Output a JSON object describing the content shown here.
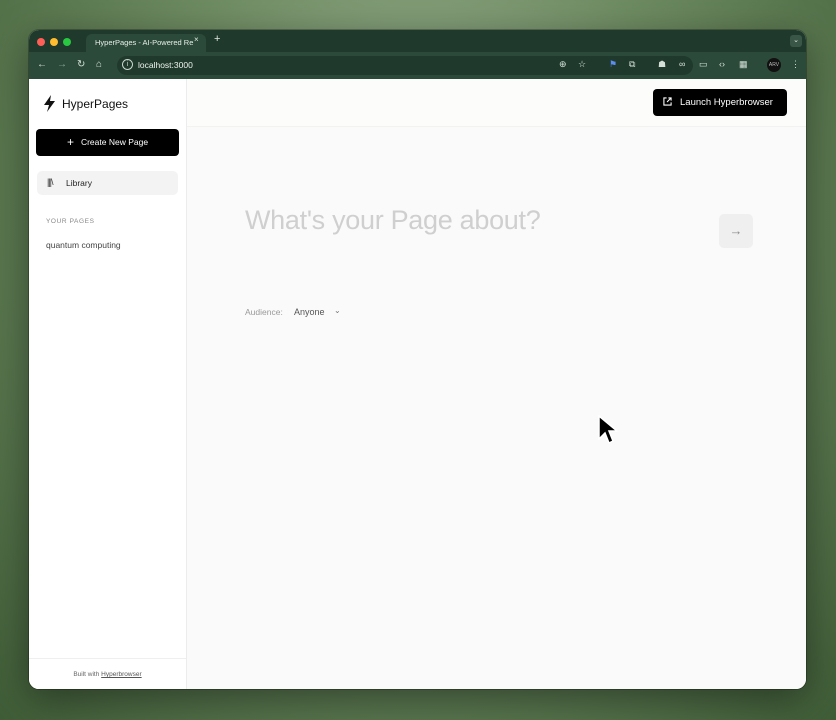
{
  "browser": {
    "tab_title": "HyperPages - AI-Powered Re",
    "tab_close": "×",
    "new_tab": "+",
    "url": "localhost:3000",
    "icons": [
      "back-icon",
      "forward-icon",
      "reload-icon",
      "home-icon",
      "site-info-icon",
      "zoom-icon",
      "bookmark-star-icon",
      "extension-icon",
      "puzzle-icon",
      "profile-avatar",
      "menu-icon"
    ],
    "profile_initials": "ARV"
  },
  "sidebar": {
    "brand": "HyperPages",
    "create_label": "Create New Page",
    "library_label": "Library",
    "section_title": "YOUR PAGES",
    "pages": [
      "quantum computing"
    ],
    "footer_prefix": "Built with",
    "footer_link": "Hyperbrowser"
  },
  "main": {
    "launch_label": "Launch Hyperbrowser",
    "prompt_placeholder": "What's your Page about?",
    "audience_label": "Audience:",
    "audience_value": "Anyone"
  }
}
